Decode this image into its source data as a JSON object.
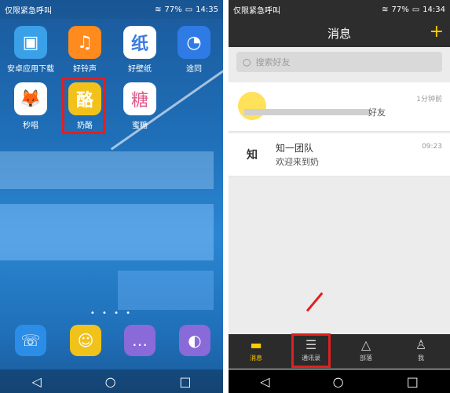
{
  "left_screen": {
    "status": {
      "carrier": "仅限紧急呼叫",
      "battery": "77%",
      "time": "14:35"
    },
    "apps": [
      {
        "label": "安卓应用下载",
        "icon": "bag-icon",
        "color": "#3aa0e8"
      },
      {
        "label": "好铃声",
        "icon": "music-note-icon",
        "color": "#ff8a1e"
      },
      {
        "label": "好壁纸",
        "icon": "wallpaper-icon",
        "color": "#ffffff"
      },
      {
        "label": "途同",
        "icon": "ghost-icon",
        "color": "#2f7be6"
      },
      {
        "label": "秒唱",
        "icon": "fox-icon",
        "color": "#f0a030"
      },
      {
        "label": "奶酪",
        "icon": "cheese-icon",
        "color": "#f3c21a"
      },
      {
        "label": "蜜糖",
        "icon": "candy-icon",
        "color": "#ffffff"
      }
    ],
    "dock": [
      {
        "icon": "phone-icon",
        "color": "#2b8de6"
      },
      {
        "icon": "contacts-icon",
        "color": "#f0c21a"
      },
      {
        "icon": "message-icon",
        "color": "#8a6ad8"
      },
      {
        "icon": "browser-icon",
        "color": "#8a6ad8"
      }
    ],
    "pager": "• • • •"
  },
  "right_screen": {
    "status": {
      "carrier": "仅限紧急呼叫",
      "battery": "77%",
      "time": "14:34"
    },
    "title": "消息",
    "add_symbol": "+",
    "search_placeholder": "搜索好友",
    "chats": [
      {
        "name": "",
        "message": "好友",
        "time": "1分钟前"
      },
      {
        "name": "知一团队",
        "message": "欢迎来到奶",
        "time": "09:23",
        "avatar_text": "知"
      }
    ],
    "tabs": [
      {
        "label": "消息",
        "icon": "chat-bubble-icon"
      },
      {
        "label": "通讯录",
        "icon": "contacts-list-icon"
      },
      {
        "label": "部落",
        "icon": "tent-icon"
      },
      {
        "label": "我",
        "icon": "person-icon"
      }
    ]
  },
  "colors": {
    "accent": "#ffcc00",
    "highlight": "#e02020",
    "bar": "#2d2d2d"
  }
}
